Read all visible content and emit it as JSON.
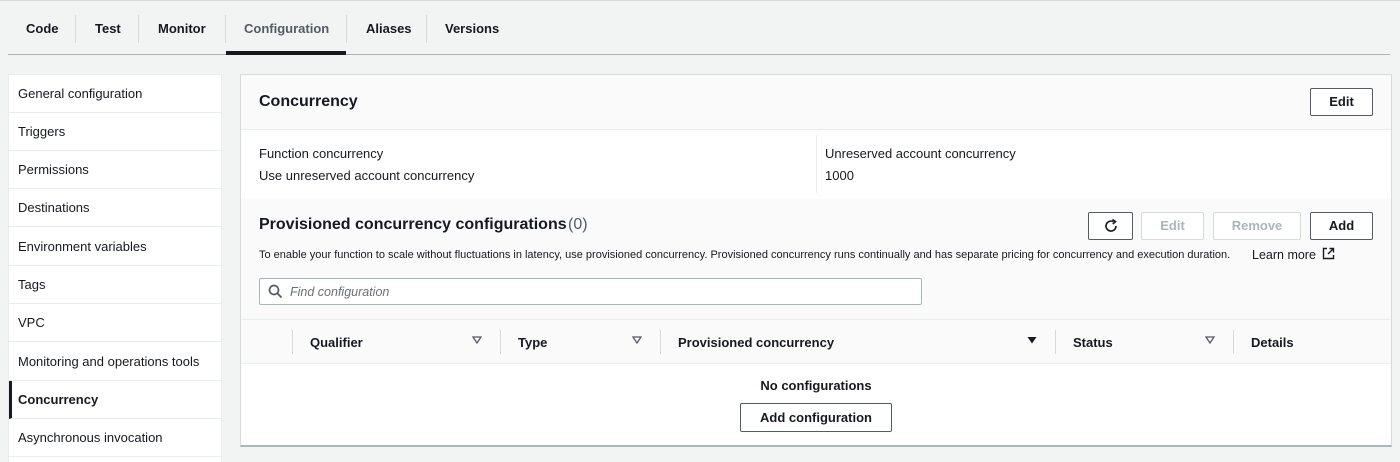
{
  "tabs": [
    {
      "label": "Code"
    },
    {
      "label": "Test"
    },
    {
      "label": "Monitor"
    },
    {
      "label": "Configuration"
    },
    {
      "label": "Aliases"
    },
    {
      "label": "Versions"
    }
  ],
  "sidebar": {
    "items": [
      {
        "label": "General configuration"
      },
      {
        "label": "Triggers"
      },
      {
        "label": "Permissions"
      },
      {
        "label": "Destinations"
      },
      {
        "label": "Environment variables"
      },
      {
        "label": "Tags"
      },
      {
        "label": "VPC"
      },
      {
        "label": "Monitoring and operations tools"
      },
      {
        "label": "Concurrency"
      },
      {
        "label": "Asynchronous invocation"
      }
    ]
  },
  "concurrency": {
    "title": "Concurrency",
    "edit_label": "Edit",
    "function_concurrency_label": "Function concurrency",
    "function_concurrency_value": "Use unreserved account concurrency",
    "unreserved_label": "Unreserved account concurrency",
    "unreserved_value": "1000"
  },
  "provisioned": {
    "title": "Provisioned concurrency configurations",
    "count": "(0)",
    "refresh_icon": "refresh-icon",
    "edit_label": "Edit",
    "remove_label": "Remove",
    "add_label": "Add",
    "description": "To enable your function to scale without fluctuations in latency, use provisioned concurrency. Provisioned concurrency runs continually and has separate pricing for concurrency and execution duration.",
    "learn_more": "Learn more",
    "search_placeholder": "Find configuration",
    "columns": [
      {
        "label": "Qualifier"
      },
      {
        "label": "Type"
      },
      {
        "label": "Provisioned concurrency"
      },
      {
        "label": "Status"
      },
      {
        "label": "Details"
      }
    ],
    "empty_text": "No configurations",
    "add_configuration_label": "Add configuration"
  },
  "colors": {
    "text": "#16191f",
    "border": "#aab7b8",
    "background": "#f2f3f3"
  }
}
